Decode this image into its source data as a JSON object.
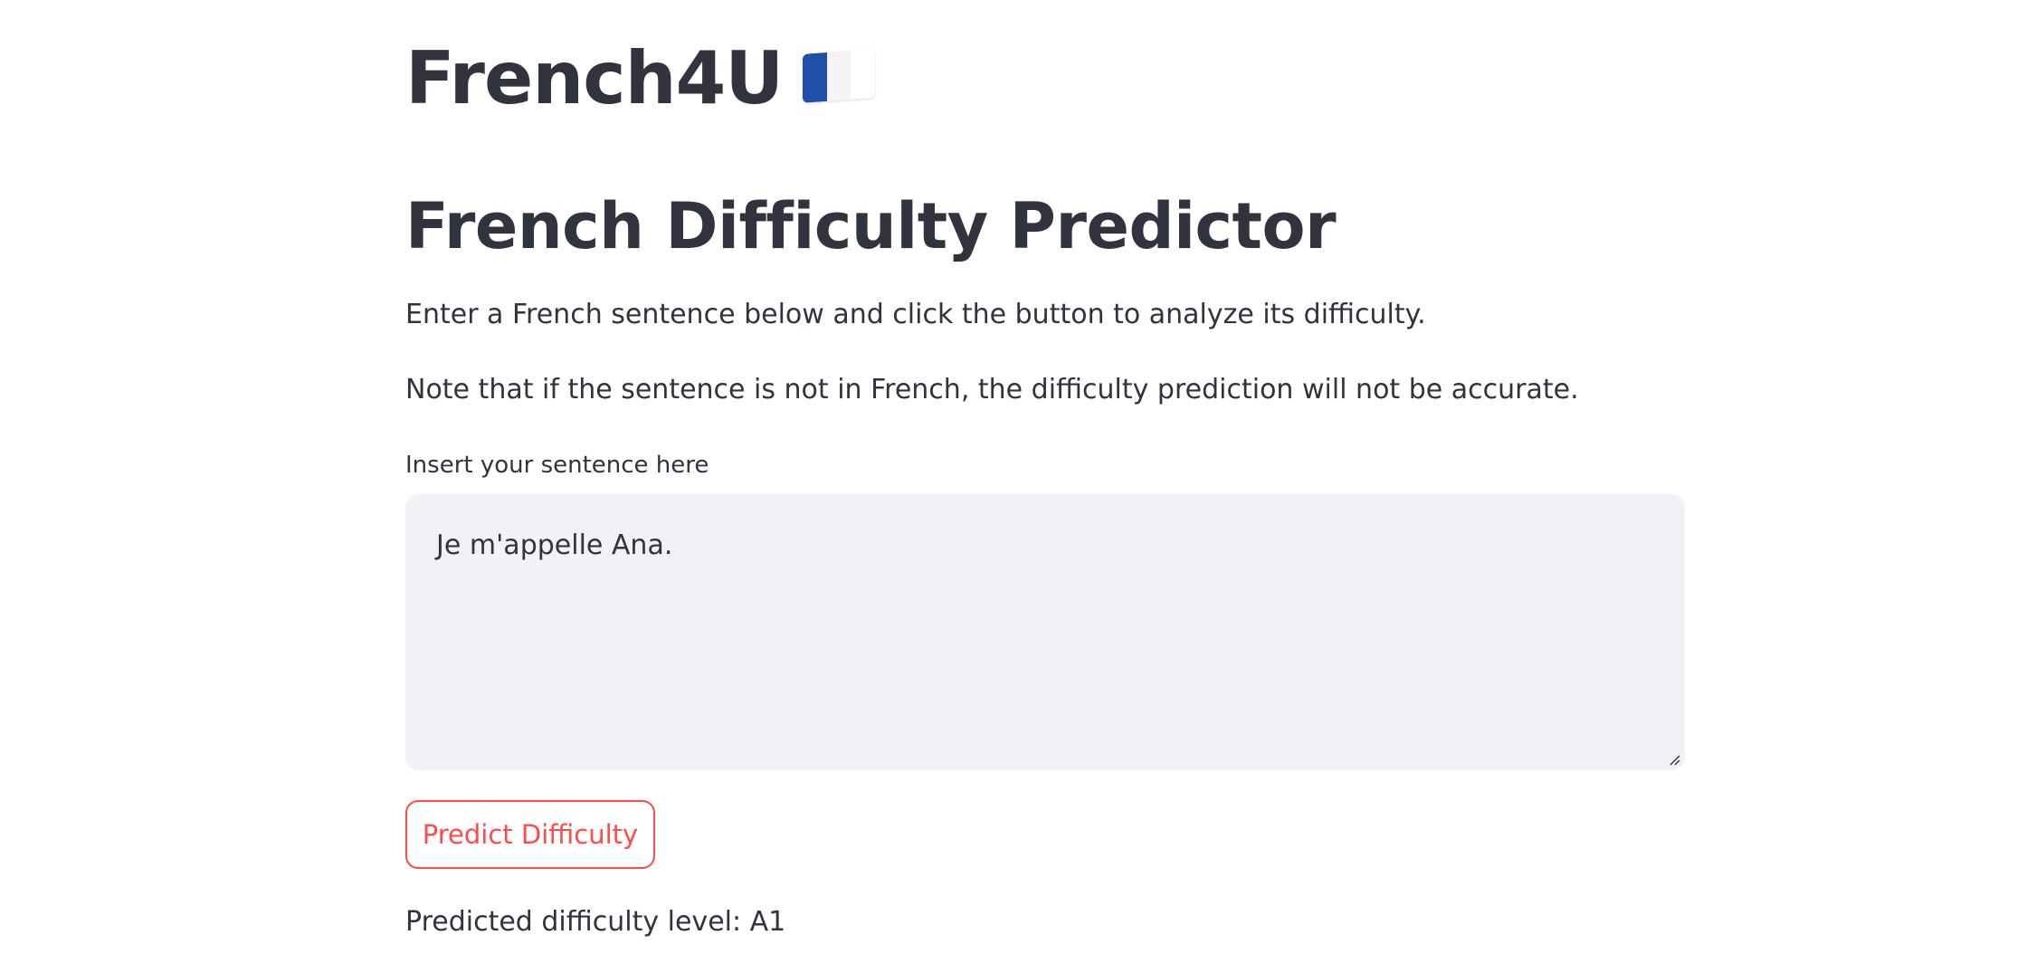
{
  "app": {
    "title": "French4U",
    "flag_icon": "france-flag-icon",
    "flag_colors": [
      "#1f4fa8",
      "#f4f4f4",
      "#e0262d"
    ]
  },
  "main": {
    "heading": "French Difficulty Predictor",
    "instructions": "Enter a French sentence below and click the button to analyze its difficulty.",
    "note": "Note that if the sentence is not in French, the difficulty prediction will not be accurate."
  },
  "input": {
    "label": "Insert your sentence here",
    "value": "Je m'appelle Ana."
  },
  "actions": {
    "predict_label": "Predict Difficulty",
    "accent_color": "#ff4b4b"
  },
  "result": {
    "text": "Predicted difficulty level: A1"
  }
}
